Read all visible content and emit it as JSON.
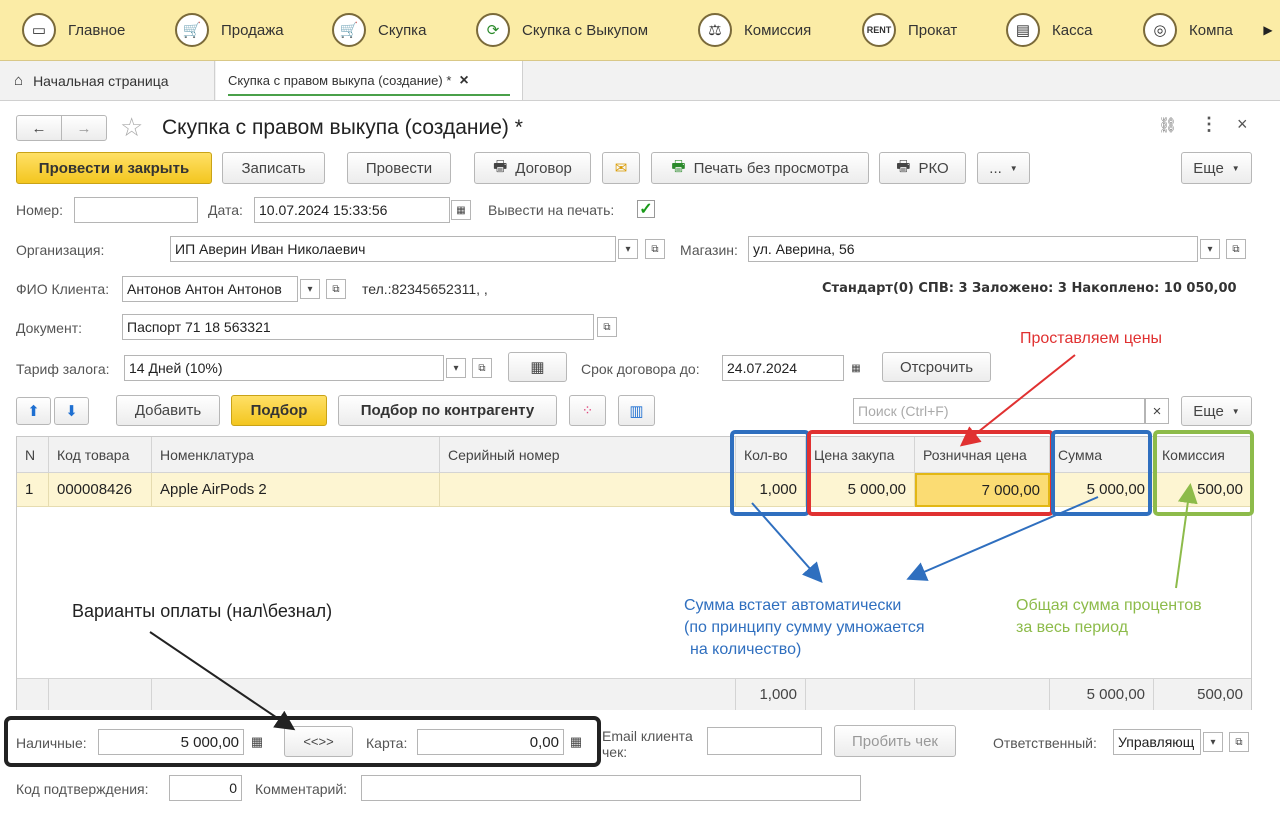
{
  "sections": [
    {
      "label": "Главное",
      "icon": "computer-icon"
    },
    {
      "label": "Продажа",
      "icon": "cart-icon"
    },
    {
      "label": "Скупка",
      "icon": "cart-icon"
    },
    {
      "label": "Скупка с Выкупом",
      "icon": "cycle-icon"
    },
    {
      "label": "Комиссия",
      "icon": "scales-icon"
    },
    {
      "label": "Прокат",
      "icon": "rent-icon"
    },
    {
      "label": "Касса",
      "icon": "cash-register-icon"
    },
    {
      "label": "Компа",
      "icon": "company-icon"
    }
  ],
  "tabs": {
    "home": "Начальная страница",
    "doc": "Скупка с правом выкупа (создание) *",
    "close": "×"
  },
  "window": {
    "title": "Скупка с правом выкупа (создание) *",
    "back": "←",
    "forward": "→",
    "star": "☆",
    "link": "🔗",
    "menu": "⋮",
    "close": "×"
  },
  "toolbar": {
    "post_close": "Провести и закрыть",
    "save": "Записать",
    "post": "Провести",
    "contract": "Договор",
    "mail": "✉",
    "print_no_preview": "Печать без просмотра",
    "rko": "РКО",
    "more": "...",
    "more2": "Еще"
  },
  "form": {
    "number_label": "Номер:",
    "number_value": "",
    "date_label": "Дата:",
    "date_value": "10.07.2024 15:33:56",
    "print_label": "Вывести на печать:",
    "print_checked": true,
    "org_label": "Организация:",
    "org_value": "ИП Аверин Иван Николаевич",
    "shop_label": "Магазин:",
    "shop_value": "ул. Аверина, 56",
    "client_label": "ФИО Клиента:",
    "client_value": "Антонов Антон Антонов",
    "phone": "тел.:82345652311, ,",
    "client_stats": "Стандарт(0) СПВ: 3 Заложено: 3 Накоплено: 10 050,00",
    "doc_label": "Документ:",
    "doc_value": "Паспорт 71 18 563321",
    "tariff_label": "Тариф залога:",
    "tariff_value": "14 Дней (10%)",
    "term_label": "Срок договора до:",
    "term_value": "24.07.2024",
    "postpone": "Отсрочить"
  },
  "table_toolbar": {
    "add": "Добавить",
    "pick": "Подбор",
    "pick_counterparty": "Подбор по контрагенту",
    "search_placeholder": "Поиск (Ctrl+F)",
    "clear": "×",
    "more": "Еще"
  },
  "table": {
    "headers": [
      "N",
      "Код товара",
      "Номенклатура",
      "Серийный номер",
      "Кол-во",
      "Цена закупа",
      "Розничная цена",
      "Сумма",
      "Комиссия"
    ],
    "rows": [
      [
        "1",
        "000008426",
        "Apple AirPods 2",
        "",
        "1,000",
        "5 000,00",
        "7 000,00",
        "5 000,00",
        "500,00"
      ]
    ],
    "totals": {
      "qty": "1,000",
      "sum": "5 000,00",
      "commission": "500,00"
    }
  },
  "payment": {
    "cash_label": "Наличные:",
    "cash_value": "5 000,00",
    "swap": "<<>>",
    "card_label": "Карта:",
    "card_value": "0,00",
    "email_label": "Email клиента чек:",
    "email_value": "",
    "punch": "Пробить чек",
    "responsible_label": "Ответственный:",
    "responsible_value": "Управляющ"
  },
  "footer": {
    "code_label": "Код подтверждения:",
    "code_value": "0",
    "comment_label": "Комментарий:",
    "comment_value": ""
  },
  "annotations": {
    "prices": "Проставляем цены",
    "sum_auto_1": "Сумма встает автоматически",
    "sum_auto_2": "(по принципу сумму умножается",
    "sum_auto_3": "на количество)",
    "commission_1": "Общая сумма процентов",
    "commission_2": "за весь период",
    "payment": "Варианты оплаты (нал\\безнал)"
  },
  "colors": {
    "red": "#e03131",
    "blue": "#2f6fbf",
    "green": "#8dbb4a",
    "dark": "#222222",
    "yellow_bar": "#fbeca6"
  }
}
